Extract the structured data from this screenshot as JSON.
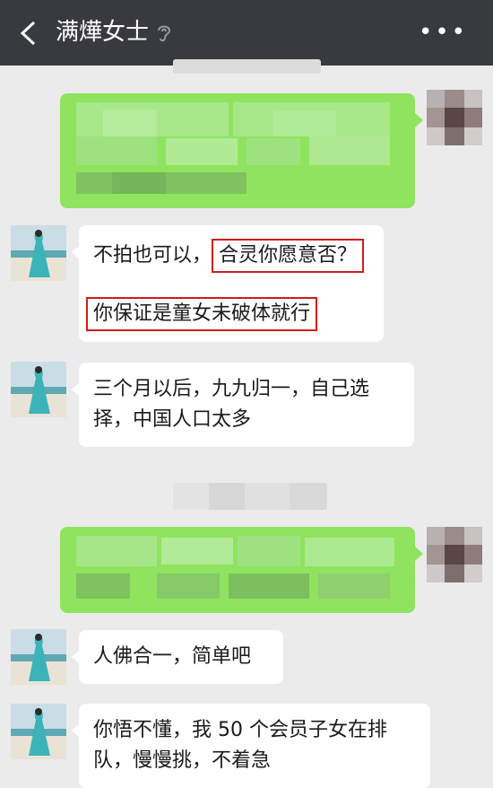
{
  "header": {
    "title": "满燁女士",
    "back_icon": "chevron-left-icon",
    "ear_icon": "ear-icon",
    "more_icon": "more-dots-icon"
  },
  "messages": [
    {
      "side": "right",
      "blurred": true
    },
    {
      "side": "left",
      "text_a": "不拍也可以，",
      "text_b": "合灵你愿意否？",
      "text_c": "你保证是童女未破体就行"
    },
    {
      "side": "left",
      "text": "三个月以后，九九归一，自己选择，中国人口太多"
    },
    {
      "side": "right",
      "blurred": true
    },
    {
      "side": "left",
      "text": "人佛合一，简单吧"
    },
    {
      "side": "left",
      "text": "你悟不懂，我 50 个会员子女在排队，慢慢挑，不着急"
    }
  ],
  "colors": {
    "header_bg": "#393a3f",
    "chat_bg": "#ebebeb",
    "sent_bubble": "#8fe35e",
    "received_bubble": "#ffffff",
    "highlight_border": "#d11a1a"
  }
}
